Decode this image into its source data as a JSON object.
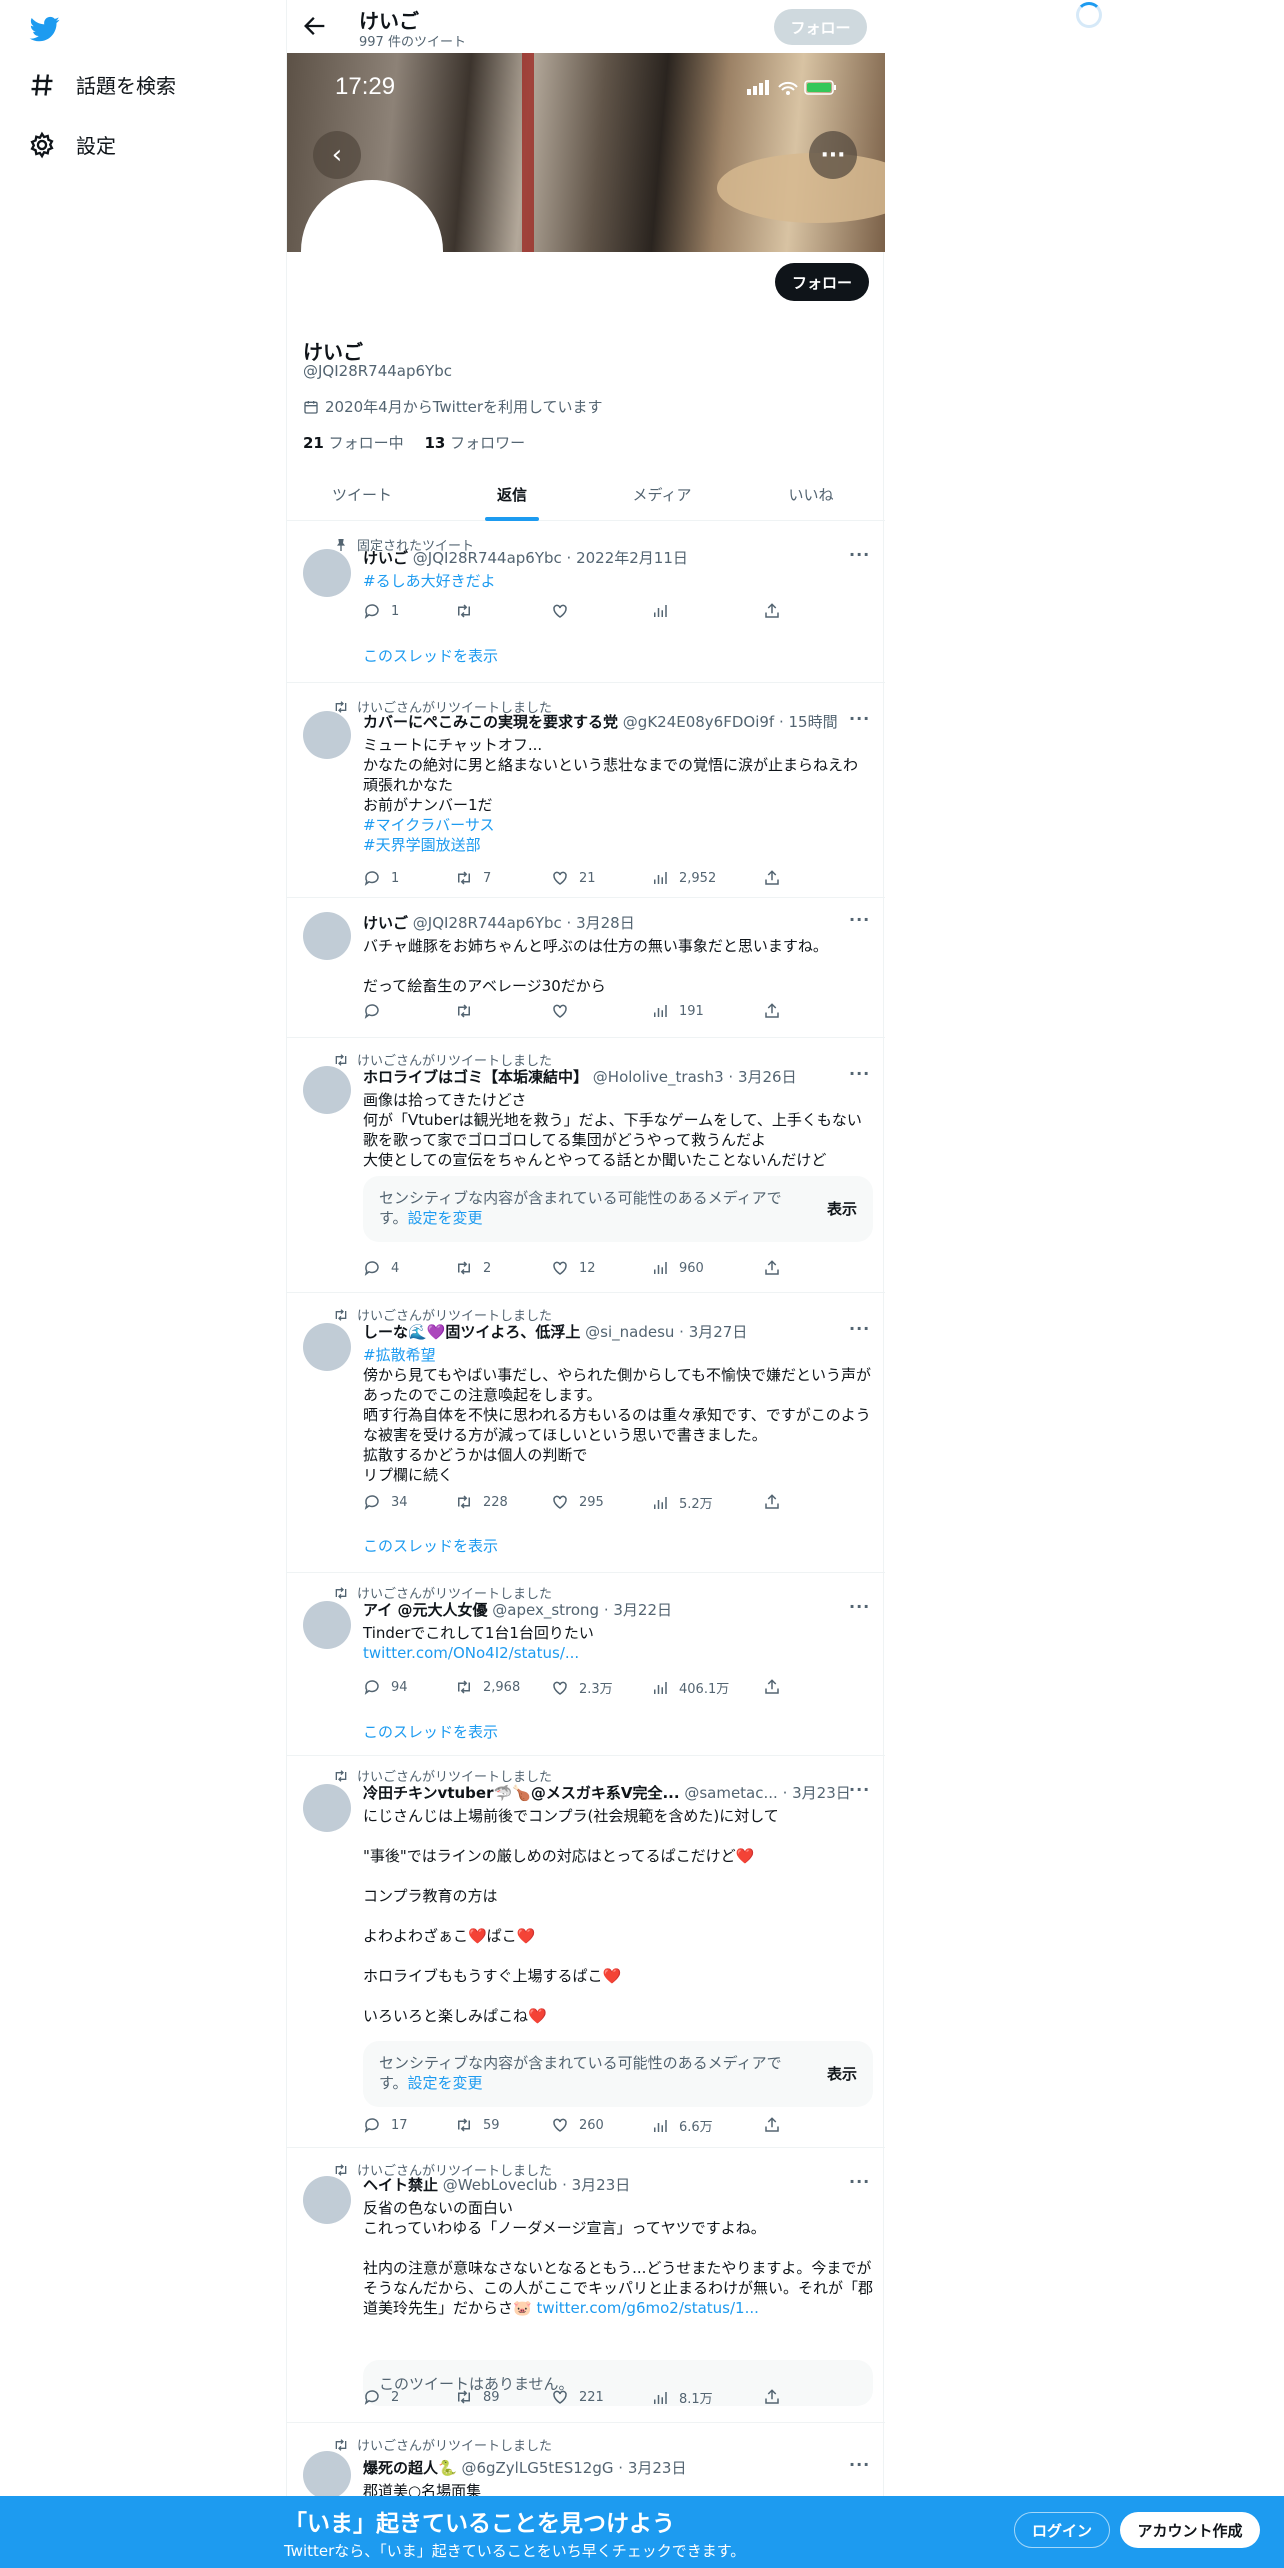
{
  "nav": {
    "explore_label": "話題を検索",
    "settings_label": "設定"
  },
  "header": {
    "name": "けいご",
    "tweet_count": "997 件のツイート",
    "follow_label": "フォロー"
  },
  "banner": {
    "time": "17:29"
  },
  "profile": {
    "follow_label": "フォロー",
    "name": "けいご",
    "handle": "@JQI28R744ap6Ybc",
    "joined": "2020年4月からTwitterを利用しています",
    "following_count": "21",
    "following_label": "フォロー中",
    "followers_count": "13",
    "followers_label": "フォロワー"
  },
  "tabs": [
    "ツイート",
    "返信",
    "メディア",
    "いいね"
  ],
  "active_tab": "返信",
  "tweets": [
    {
      "social": "固定されたツイート",
      "name": "けいご",
      "handle": "@JQI28R744ap6Ybc",
      "time": "2022年2月11日",
      "body": "",
      "hashtags": [
        "#るしあ大好きだよ"
      ],
      "replies": "1",
      "retweets": "",
      "likes": "",
      "views": "",
      "show_thread": "このスレッドを表示"
    },
    {
      "social": "けいごさんがリツイートしました",
      "name": "カバーにぺこみこの実現を要求する党",
      "handle": "@gK24E08y6FDOi9f",
      "time": "15時間",
      "body": "ミュートにチャットオフ...\nかなたの絶対に男と絡まないという悲壮なまでの覚悟に涙が止まらねえわ\n頑張れかなた\nお前がナンバー1だ",
      "hashtags": [
        "#マイクラバーサス",
        "#天界学園放送部"
      ],
      "replies": "1",
      "retweets": "7",
      "likes": "21",
      "views": "2,952"
    },
    {
      "social": "",
      "name": "けいご",
      "handle": "@JQI28R744ap6Ybc",
      "time": "3月28日",
      "body": "バチャ雌豚をお姉ちゃんと呼ぶのは仕方の無い事象だと思いますね。\n\nだって絵畜生のアベレージ30だから",
      "replies": "",
      "retweets": "",
      "likes": "",
      "views": "191"
    },
    {
      "social": "けいごさんがリツイートしました",
      "name": "ホロライブはゴミ【本垢凍結中】",
      "handle": "@Hololive_trash3",
      "time": "3月26日",
      "body": "画像は拾ってきたけどさ\n何が「Vtuberは観光地を救う」だよ、下手なゲームをして、上手くもない歌を歌って家でゴロゴロしてる集団がどうやって救うんだよ\n大使としての宣伝をちゃんとやってる話とか聞いたことないんだけど",
      "sensitive": "センシティブな内容が含まれている可能性のあるメディアです。",
      "sensitive_link": "設定を変更",
      "show": "表示",
      "replies": "4",
      "retweets": "2",
      "likes": "12",
      "views": "960"
    },
    {
      "social": "けいごさんがリツイートしました",
      "name": "しーな🌊💜固ツイよろ、低浮上",
      "handle": "@si_nadesu",
      "time": "3月27日",
      "hashtags": [
        "#拡散希望"
      ],
      "body": "傍から見てもやばい事だし、やられた側からしても不愉快で嫌だという声があったのでこの注意喚起をします。\n晒す行為自体を不快に思われる方もいるのは重々承知です、ですがこのような被害を受ける方が減ってほしいという思いで書きました。\n拡散するかどうかは個人の判断で\nリプ欄に続く",
      "replies": "34",
      "retweets": "228",
      "likes": "295",
      "views": "5.2万",
      "show_thread": "このスレッドを表示"
    },
    {
      "social": "けいごさんがリツイートしました",
      "name": "アイ @元大人女優",
      "handle": "@apex_strong",
      "time": "3月22日",
      "body": "Tinderでこれして1台1台回りたい",
      "link": "twitter.com/ONo4I2/status/...",
      "replies": "94",
      "retweets": "2,968",
      "likes": "2.3万",
      "views": "406.1万",
      "show_thread": "このスレッドを表示"
    },
    {
      "social": "けいごさんがリツイートしました",
      "name": "冷田チキンvtuber🦈🍗@メスガキ系V完全...",
      "handle": "@sametac...",
      "time": "3月23日",
      "body": "にじさんじは上場前後でコンプラ(社会規範を含めた)に対して\n\n\"事後\"ではラインの厳しめの対応はとってるぱこだけど❤️\n\nコンプラ教育の方は\n\nよわよわざぁこ❤️ぱこ❤️\n\nホロライブももうすぐ上場するぱこ❤️\n\nいろいろと楽しみぱこね❤️",
      "sensitive": "センシティブな内容が含まれている可能性のあるメディアです。",
      "sensitive_link": "設定を変更",
      "show": "表示",
      "replies": "17",
      "retweets": "59",
      "likes": "260",
      "views": "6.6万"
    },
    {
      "social": "けいごさんがリツイートしました",
      "name": "ヘイト禁止",
      "handle": "@WebLoveclub",
      "time": "3月23日",
      "body": "反省の色ないの面白い\nこれっていわゆる「ノーダメージ宣言」ってヤツですよね。\n\n社内の注意が意味なさないとなるともう...どうせまたやりますよ。今までがそうなんだから、この人がここでキッパリと止まるわけが無い。それが「郡道美玲先生」だからさ🐷",
      "link": "twitter.com/g6mo2/status/1...",
      "unavailable": "このツイートはありません。",
      "replies": "2",
      "retweets": "89",
      "likes": "221",
      "views": "8.1万"
    },
    {
      "social": "けいごさんがリツイートしました",
      "name": "爆死の超人🐍",
      "handle": "@6gZylLG5tES12gG",
      "time": "3月23日",
      "body": "郡道美○名場面集"
    }
  ],
  "bottom_bar": {
    "title": "「いま」起きていることを見つけよう",
    "subtitle": "Twitterなら、「いま」起きていることをいち早くチェックできます。",
    "login_label": "ログイン",
    "signup_label": "アカウント作成"
  },
  "colors": {
    "accent": "#1d9bf0",
    "text": "#0f1419",
    "muted": "#536471"
  }
}
